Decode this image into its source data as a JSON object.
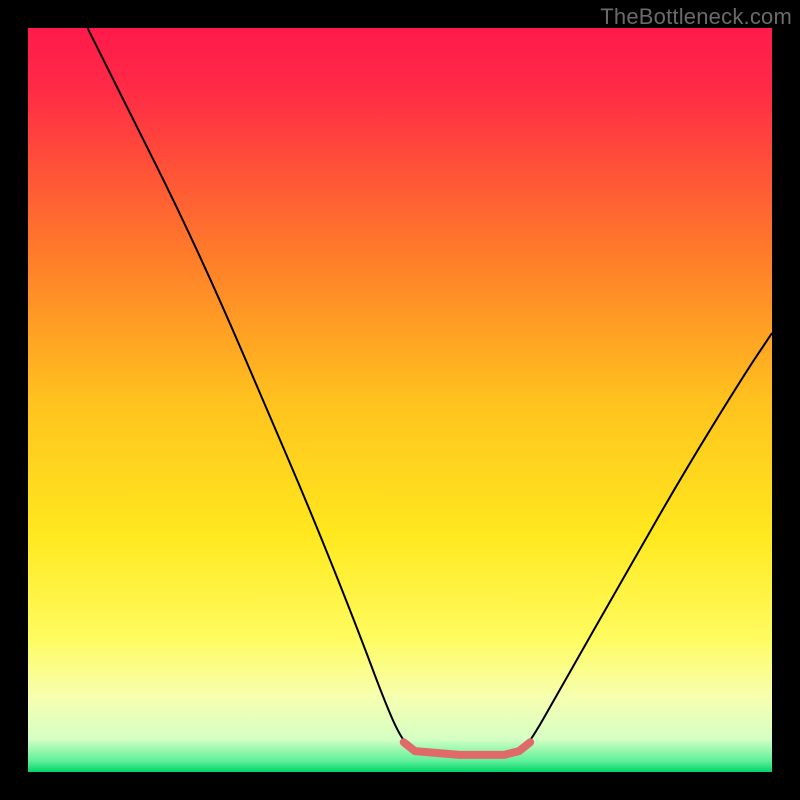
{
  "watermark": "TheBottleneck.com",
  "chart_data": {
    "type": "line",
    "title": "",
    "xlabel": "",
    "ylabel": "",
    "xlim": [
      0,
      100
    ],
    "ylim": [
      0,
      100
    ],
    "grid": false,
    "legend": false,
    "gradient_stops": [
      {
        "offset": 0.0,
        "color": "#ff1a4b"
      },
      {
        "offset": 0.08,
        "color": "#ff2a46"
      },
      {
        "offset": 0.3,
        "color": "#ff7a2a"
      },
      {
        "offset": 0.5,
        "color": "#ffc21e"
      },
      {
        "offset": 0.68,
        "color": "#ffe81e"
      },
      {
        "offset": 0.82,
        "color": "#fffc60"
      },
      {
        "offset": 0.9,
        "color": "#f6ffb0"
      },
      {
        "offset": 0.955,
        "color": "#d6ffc4"
      },
      {
        "offset": 0.985,
        "color": "#60f09a"
      },
      {
        "offset": 1.0,
        "color": "#00d46a"
      }
    ],
    "series": [
      {
        "name": "bottleneck-curve",
        "color": "#000000",
        "width": 2,
        "points": [
          {
            "x": 8.0,
            "y": 100.0
          },
          {
            "x": 14.0,
            "y": 88.0
          },
          {
            "x": 20.0,
            "y": 76.0
          },
          {
            "x": 26.0,
            "y": 63.0
          },
          {
            "x": 32.0,
            "y": 49.0
          },
          {
            "x": 38.0,
            "y": 35.0
          },
          {
            "x": 44.0,
            "y": 20.0
          },
          {
            "x": 48.5,
            "y": 8.0
          },
          {
            "x": 50.5,
            "y": 4.0
          },
          {
            "x": 52.0,
            "y": 2.8
          },
          {
            "x": 58.0,
            "y": 2.3
          },
          {
            "x": 64.0,
            "y": 2.3
          },
          {
            "x": 66.0,
            "y": 2.8
          },
          {
            "x": 67.5,
            "y": 4.0
          },
          {
            "x": 72.0,
            "y": 12.0
          },
          {
            "x": 80.0,
            "y": 26.0
          },
          {
            "x": 88.0,
            "y": 40.0
          },
          {
            "x": 96.0,
            "y": 53.0
          },
          {
            "x": 100.0,
            "y": 59.0
          }
        ]
      },
      {
        "name": "valley-highlight",
        "color": "#e06a6a",
        "width": 8,
        "points": [
          {
            "x": 50.5,
            "y": 4.0
          },
          {
            "x": 52.0,
            "y": 2.8
          },
          {
            "x": 58.0,
            "y": 2.3
          },
          {
            "x": 64.0,
            "y": 2.3
          },
          {
            "x": 66.0,
            "y": 2.8
          },
          {
            "x": 67.5,
            "y": 4.0
          }
        ]
      }
    ]
  }
}
